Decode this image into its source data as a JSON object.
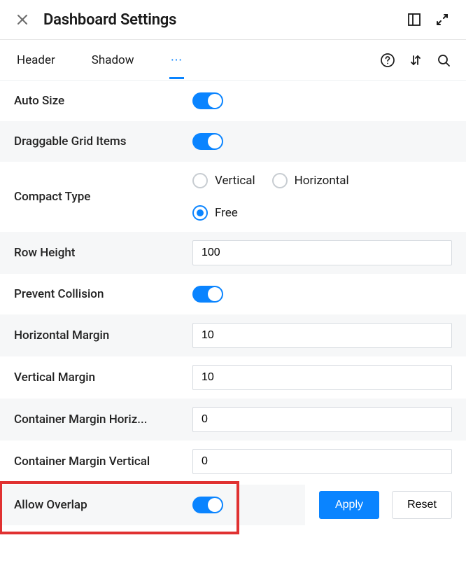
{
  "header": {
    "title": "Dashboard Settings"
  },
  "tabs": {
    "items": [
      "Header",
      "Shadow"
    ],
    "overflow_glyph": "⋯"
  },
  "settings": {
    "auto_size": {
      "label": "Auto Size",
      "value": true
    },
    "draggable_grid_items": {
      "label": "Draggable Grid Items",
      "value": true
    },
    "compact_type": {
      "label": "Compact Type",
      "options": {
        "vertical": "Vertical",
        "horizontal": "Horizontal",
        "free": "Free"
      },
      "value": "free"
    },
    "row_height": {
      "label": "Row Height",
      "value": "100"
    },
    "prevent_collision": {
      "label": "Prevent Collision",
      "value": true
    },
    "horizontal_margin": {
      "label": "Horizontal Margin",
      "value": "10"
    },
    "vertical_margin": {
      "label": "Vertical Margin",
      "value": "10"
    },
    "container_margin_horizontal": {
      "label": "Container Margin Horiz...",
      "value": "0"
    },
    "container_margin_vertical": {
      "label": "Container Margin Vertical",
      "value": "0"
    },
    "allow_overlap": {
      "label": "Allow Overlap",
      "value": true
    }
  },
  "actions": {
    "apply": "Apply",
    "reset": "Reset"
  }
}
